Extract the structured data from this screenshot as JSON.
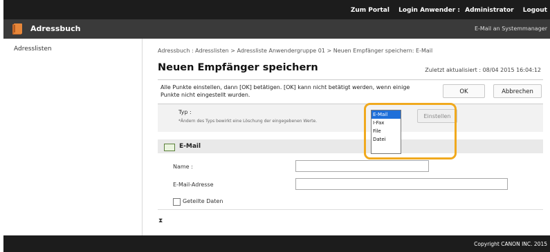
{
  "header": {
    "links": [
      "Zum Portal",
      "Login Anwender :",
      "Administrator",
      "Logout"
    ]
  },
  "titlebar": {
    "title": "Adressbuch",
    "right_link": "E-Mail an Systemmanager"
  },
  "sidebar": {
    "items": [
      {
        "label": "Adresslisten"
      }
    ]
  },
  "main": {
    "breadcrumb": "Adressbuch : Adresslisten > Adressliste Anwendergruppe 01 > Neuen Empfänger speichern: E-Mail",
    "title": "Neuen Empfänger speichern",
    "updated": "Zuletzt aktualisiert : 08/04 2015 16:04:12",
    "info_message": "Alle Punkte einstellen, dann [OK] betätigen. [OK] kann nicht betätigt werden, wenn einige Punkte nicht eingestellt wurden.",
    "ok_label": "OK",
    "cancel_label": "Abbrechen",
    "type": {
      "label": "Typ :",
      "hint": "*Ändern des Typs bewirkt eine Löschung der eingegebenen Werte.",
      "options": [
        "E-Mail",
        "I-Fax",
        "File",
        "Datei"
      ],
      "selected": "E-Mail",
      "set_button": "Einstellen"
    },
    "section": {
      "title": "E-Mail",
      "name_label": "Name :",
      "name_value": "",
      "email_label": "E-Mail-Adresse",
      "email_value": "",
      "shared_label": "Geteilte Daten"
    },
    "hourglass": "⧗"
  },
  "footer": {
    "copyright": "Copyright CANON INC. 2015"
  },
  "colors": {
    "topbar": "#1c1c1c",
    "titlebar": "#3a3a3a",
    "callout": "#f0a91e",
    "selected_option": "#1e6fd9"
  }
}
